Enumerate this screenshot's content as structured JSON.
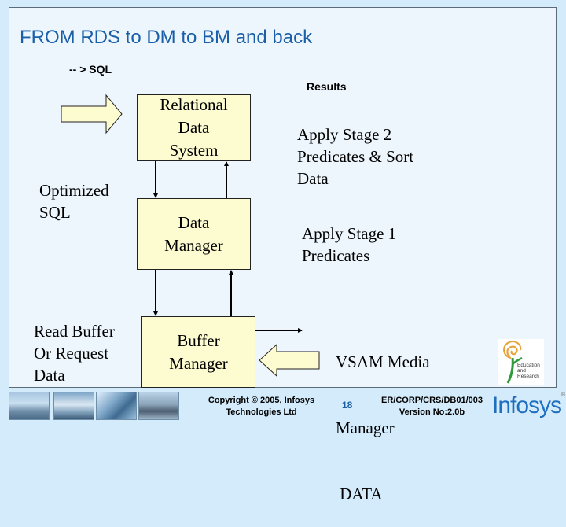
{
  "slide": {
    "title": "FROM RDS to DM to BM and back",
    "sql_label": "-- > SQL",
    "results_label": "Results"
  },
  "boxes": {
    "rds": [
      "Relational",
      "Data",
      "System"
    ],
    "dm": [
      "Data",
      "Manager"
    ],
    "bm": [
      "Buffer",
      "Manager"
    ]
  },
  "annotations": {
    "optimized_sql": [
      "Optimized",
      "SQL"
    ],
    "read_buffer": [
      "Read Buffer",
      "Or Request",
      "Data"
    ],
    "stage2": [
      "Apply Stage 2",
      "Predicates & Sort",
      "Data"
    ],
    "stage1": [
      "Apply Stage 1",
      "Predicates"
    ],
    "vsam": [
      "VSAM Media",
      "Manager",
      " DATA"
    ]
  },
  "logo": {
    "education_text": [
      "Education",
      "and",
      "Research"
    ]
  },
  "footer": {
    "copyright": [
      "Copyright © 2005, Infosys",
      "Technologies Ltd"
    ],
    "page_number": "18",
    "doc_id": [
      "ER/CORP/CRS/DB01/003",
      "Version No:2.0b"
    ],
    "brand": "Infosys",
    "brand_mark": "®",
    "thumbnails": [
      "campus-photo-1",
      "campus-photo-2",
      "campus-photo-3",
      "campus-photo-4"
    ]
  },
  "colors": {
    "title": "#1a5fa8",
    "box_fill": "#fdfbd0",
    "slide_bg": "#eef6fd",
    "outer_bg": "#d3ebfa",
    "brand": "#1f6fc0"
  }
}
